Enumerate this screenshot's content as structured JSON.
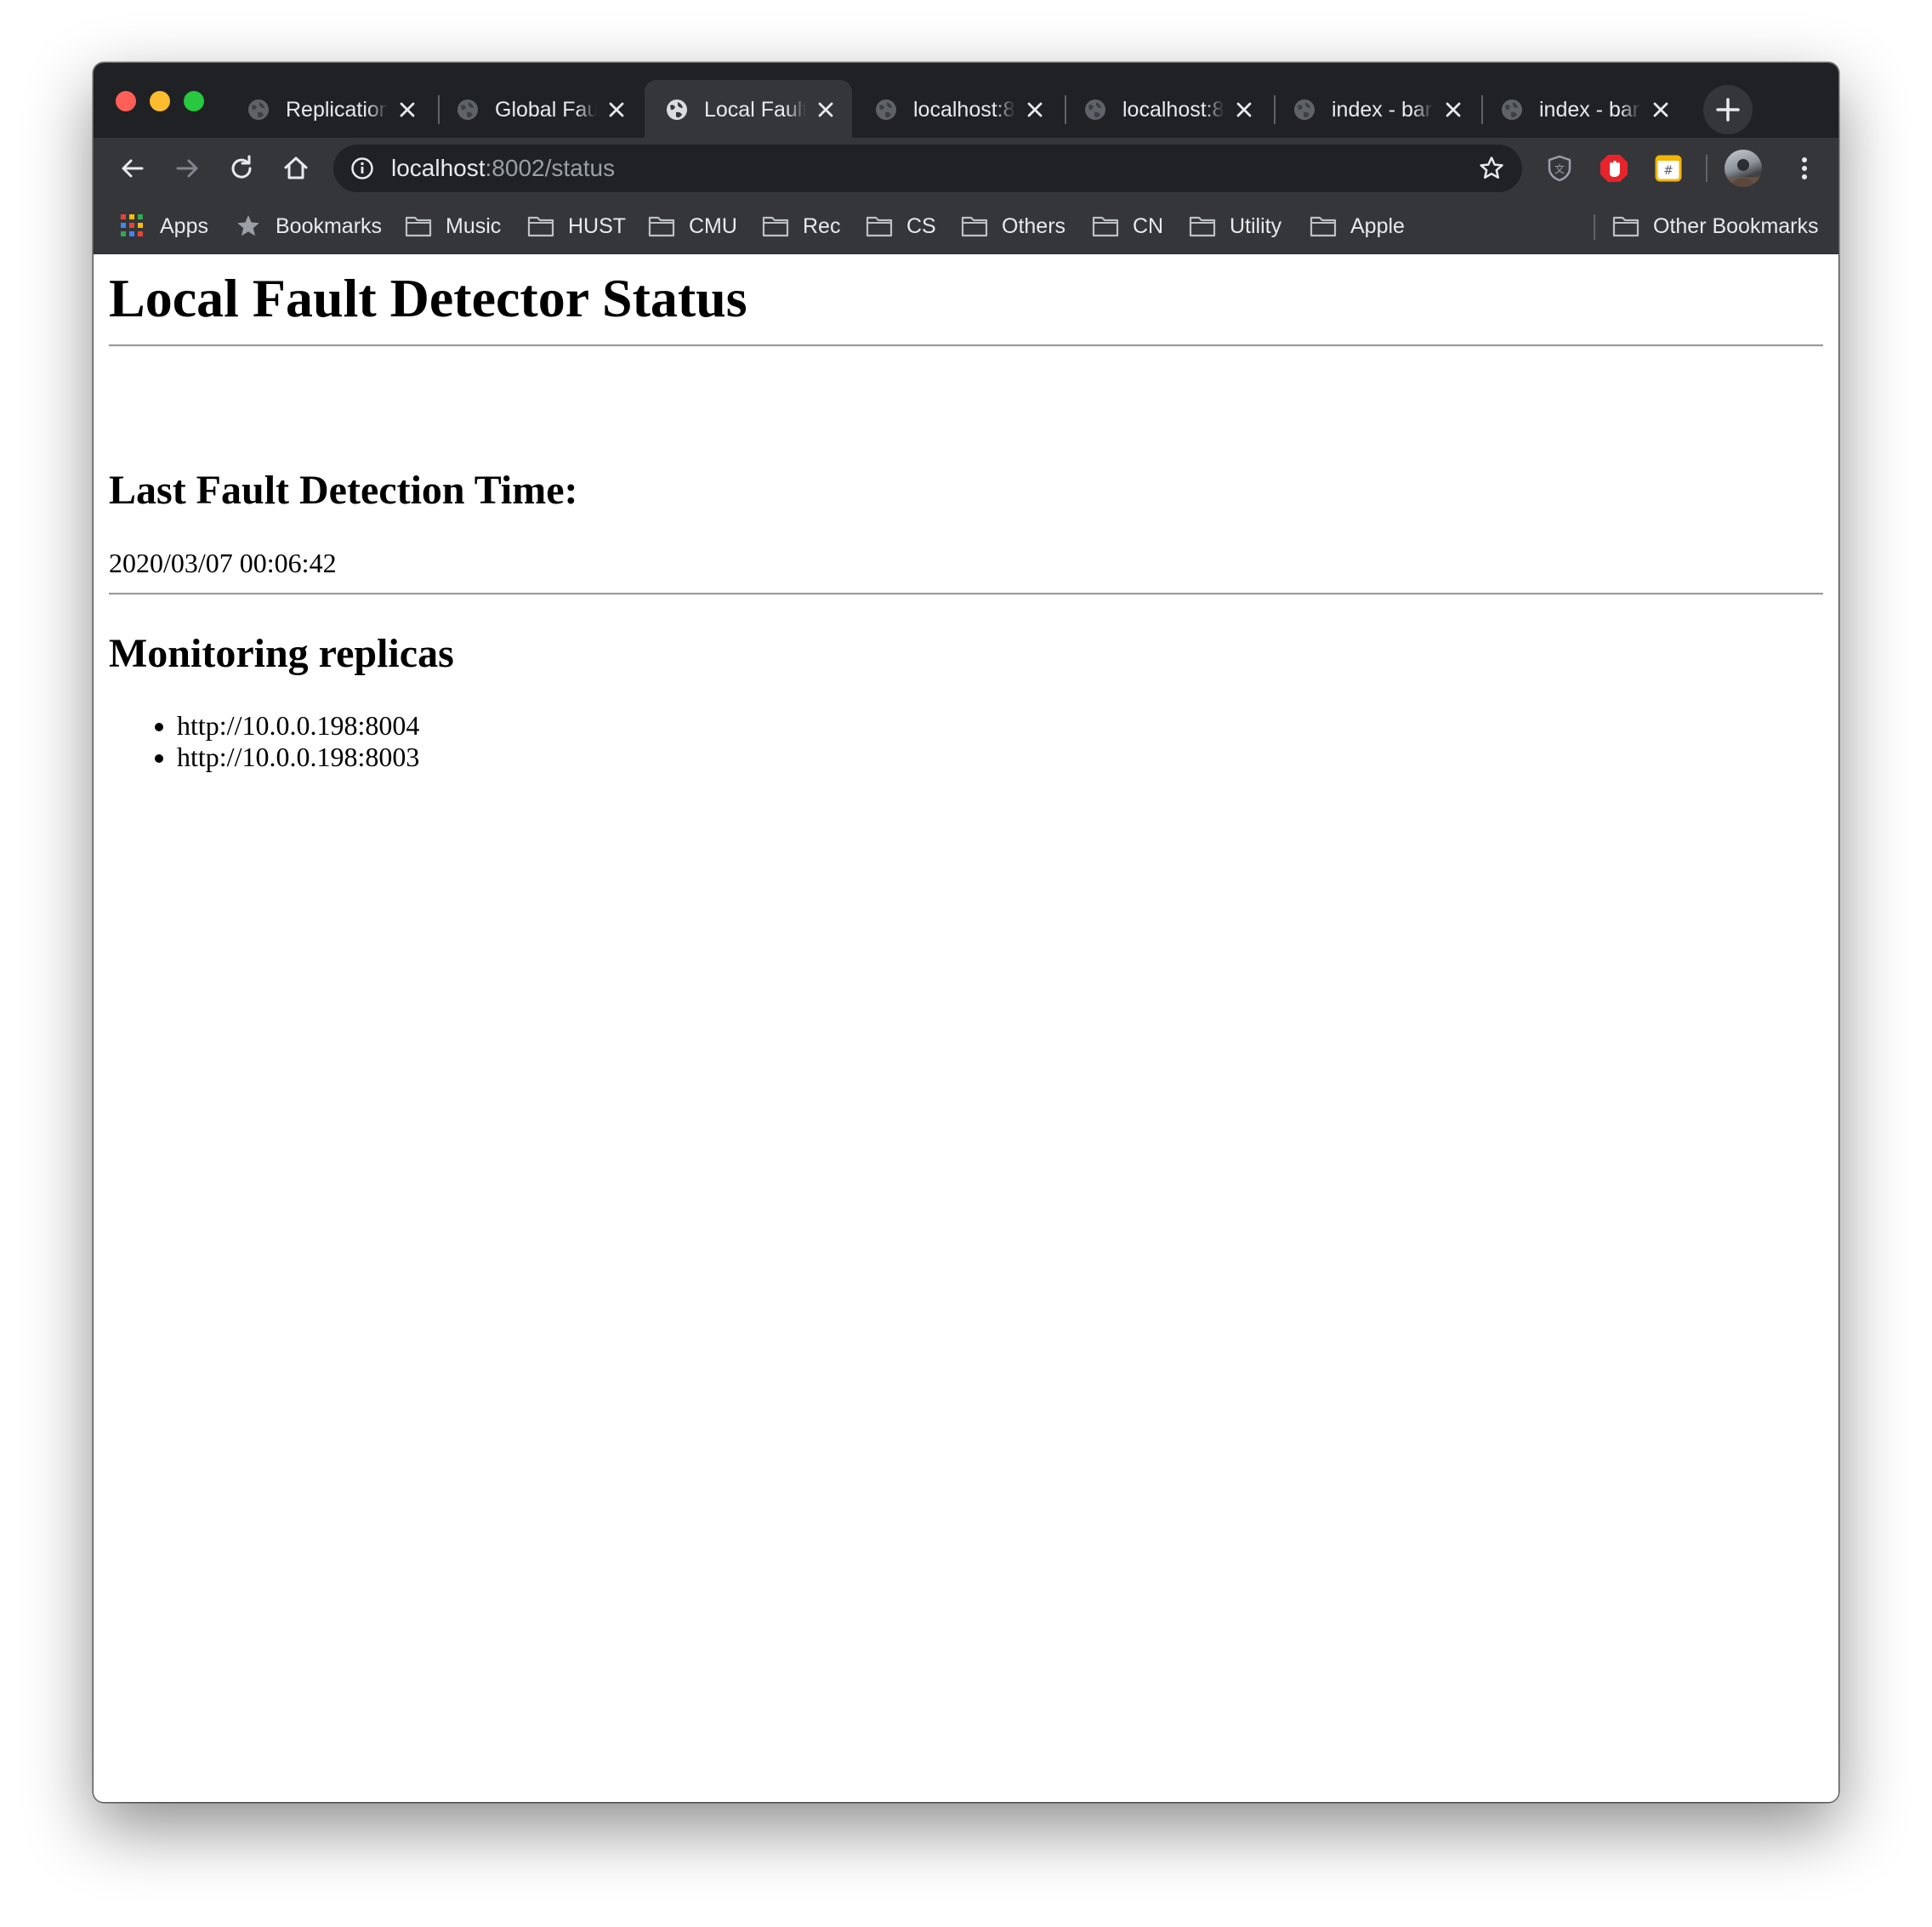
{
  "tabs": [
    {
      "title": "Replication",
      "active": false
    },
    {
      "title": "Global Fault",
      "active": false
    },
    {
      "title": "Local Fault",
      "active": true
    },
    {
      "title": "localhost:8",
      "active": false
    },
    {
      "title": "localhost:8",
      "active": false
    },
    {
      "title": "index - bar",
      "active": false
    },
    {
      "title": "index - bar",
      "active": false
    }
  ],
  "address_bar": {
    "host": "localhost",
    "path": ":8002/status"
  },
  "bookmarks": [
    {
      "label": "Apps",
      "icon": "apps-grid-icon"
    },
    {
      "label": "Bookmarks",
      "icon": "star-icon"
    },
    {
      "label": "Music",
      "icon": "folder-icon"
    },
    {
      "label": "HUST",
      "icon": "folder-icon"
    },
    {
      "label": "CMU",
      "icon": "folder-icon"
    },
    {
      "label": "Rec",
      "icon": "folder-icon"
    },
    {
      "label": "CS",
      "icon": "folder-icon"
    },
    {
      "label": "Others",
      "icon": "folder-icon"
    },
    {
      "label": "CN",
      "icon": "folder-icon"
    },
    {
      "label": "Utility",
      "icon": "folder-icon"
    },
    {
      "label": "Apple",
      "icon": "folder-icon"
    }
  ],
  "other_bookmarks": {
    "label": "Other Bookmarks",
    "icon": "folder-icon"
  },
  "page": {
    "title": "Local Fault Detector Status",
    "last_detection_heading": "Last Fault Detection Time:",
    "last_detection_time": "2020/03/07 00:06:42",
    "replicas_heading": "Monitoring replicas",
    "replicas": [
      "http://10.0.0.198:8004",
      "http://10.0.0.198:8003"
    ]
  },
  "colors": {
    "tabstrip": "#202124",
    "toolbar": "#35363a",
    "omnibox": "#202124",
    "close_red": "#ff5f57",
    "minimize_yellow": "#febc2e",
    "zoom_green": "#28c840"
  }
}
